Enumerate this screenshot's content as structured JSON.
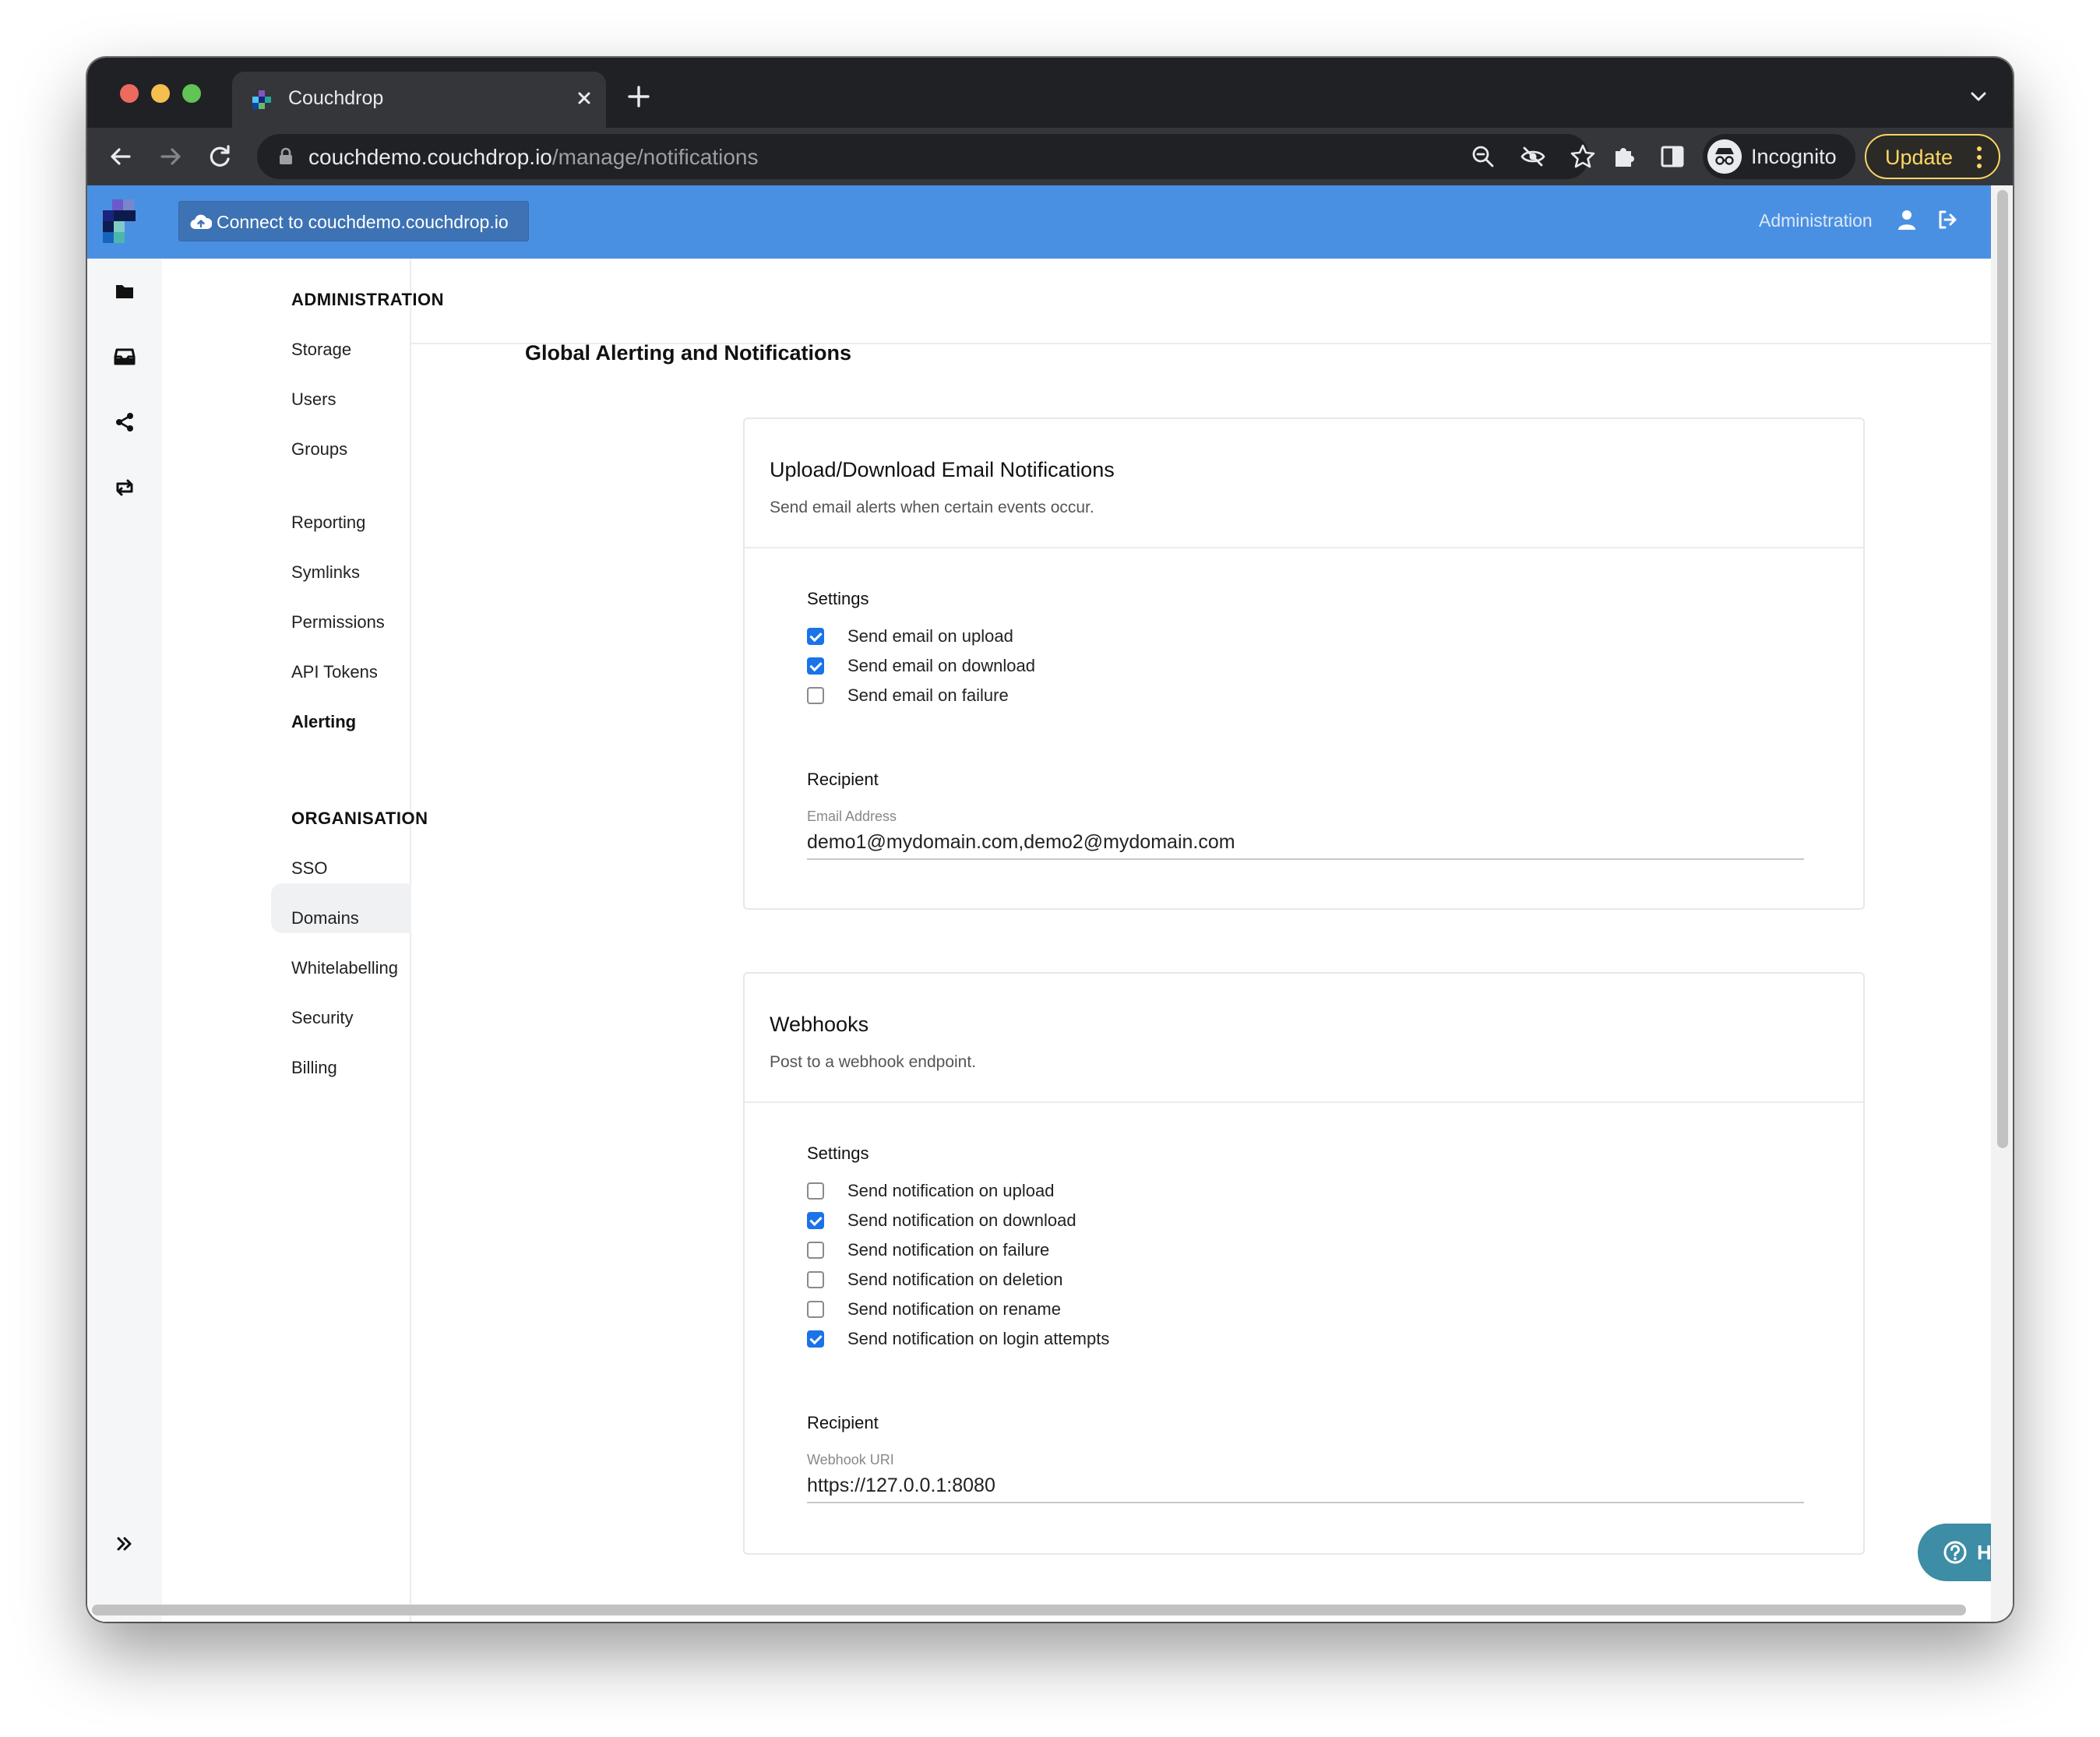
{
  "browser": {
    "tab_title": "Couchdrop",
    "url_host": "couchdemo.couchdrop.io",
    "url_path": "/manage/notifications",
    "profile_label": "Incognito",
    "update_label": "Update"
  },
  "appbar": {
    "connect_label": "Connect to couchdemo.couchdrop.io",
    "admin_label": "Administration"
  },
  "sidebar": {
    "admin_heading": "ADMINISTRATION",
    "admin_items": [
      {
        "label": "Storage"
      },
      {
        "label": "Users"
      },
      {
        "label": "Groups"
      },
      {
        "label": "Reporting"
      },
      {
        "label": "Symlinks"
      },
      {
        "label": "Permissions"
      },
      {
        "label": "API Tokens"
      },
      {
        "label": "Alerting",
        "active": true
      }
    ],
    "org_heading": "ORGANISATION",
    "org_items": [
      {
        "label": "SSO"
      },
      {
        "label": "Domains"
      },
      {
        "label": "Whitelabelling"
      },
      {
        "label": "Security"
      },
      {
        "label": "Billing"
      }
    ]
  },
  "main": {
    "title": "Global Alerting and Notifications",
    "email_card": {
      "title": "Upload/Download Email Notifications",
      "subtitle": "Send email alerts when certain events occur.",
      "settings_label": "Settings",
      "options": [
        {
          "label": "Send email on upload",
          "checked": true
        },
        {
          "label": "Send email on download",
          "checked": true
        },
        {
          "label": "Send email on failure",
          "checked": false
        }
      ],
      "recipient_label": "Recipient",
      "field_label": "Email Address",
      "field_value": "demo1@mydomain.com,demo2@mydomain.com"
    },
    "webhook_card": {
      "title": "Webhooks",
      "subtitle": "Post to a webhook endpoint.",
      "settings_label": "Settings",
      "options": [
        {
          "label": "Send notification on upload",
          "checked": false
        },
        {
          "label": "Send notification on download",
          "checked": true
        },
        {
          "label": "Send notification on failure",
          "checked": false
        },
        {
          "label": "Send notification on deletion",
          "checked": false
        },
        {
          "label": "Send notification on rename",
          "checked": false
        },
        {
          "label": "Send notification on login attempts",
          "checked": true
        }
      ],
      "recipient_label": "Recipient",
      "field_label": "Webhook URI",
      "field_value": "https://127.0.0.1:8080"
    }
  },
  "help": {
    "label": "Help"
  },
  "colors": {
    "appbar": "#4a90e2",
    "checkbox_checked": "#1a73e8",
    "help_button": "#3c8da5",
    "update_accent": "#fdd663"
  },
  "icons": {
    "rail": [
      "folder-icon",
      "inbox-icon",
      "share-icon",
      "sync-icon"
    ],
    "collapse": "double-chevron-right-icon",
    "user": "user-icon",
    "logout": "logout-icon",
    "help": "question-circle-icon"
  }
}
